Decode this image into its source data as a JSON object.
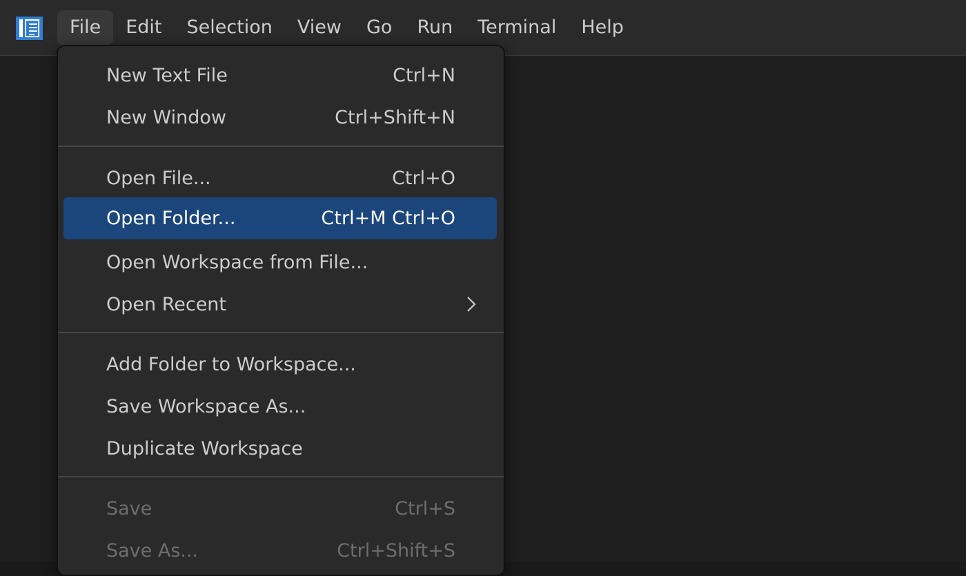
{
  "app": {
    "icon": "app-logo-icon",
    "accent_color": "#2f7fd0"
  },
  "menubar": {
    "items": [
      "File",
      "Edit",
      "Selection",
      "View",
      "Go",
      "Run",
      "Terminal",
      "Help"
    ],
    "active": "File"
  },
  "file_menu": {
    "highlight_color": "#1a467c",
    "groups": [
      [
        {
          "label": "New Text File",
          "shortcut": "Ctrl+N"
        },
        {
          "label": "New Window",
          "shortcut": "Ctrl+Shift+N"
        }
      ],
      [
        {
          "label": "Open File...",
          "shortcut": "Ctrl+O"
        },
        {
          "label": "Open Folder...",
          "shortcut": "Ctrl+M Ctrl+O",
          "highlighted": true
        },
        {
          "label": "Open Workspace from File...",
          "shortcut": ""
        },
        {
          "label": "Open Recent",
          "shortcut": "",
          "submenu_icon": "chevron-right-icon"
        }
      ],
      [
        {
          "label": "Add Folder to Workspace...",
          "shortcut": ""
        },
        {
          "label": "Save Workspace As...",
          "shortcut": ""
        },
        {
          "label": "Duplicate Workspace",
          "shortcut": ""
        }
      ],
      [
        {
          "label": "Save",
          "shortcut": "Ctrl+S",
          "disabled": true
        },
        {
          "label": "Save As...",
          "shortcut": "Ctrl+Shift+S",
          "disabled": true
        }
      ]
    ]
  }
}
